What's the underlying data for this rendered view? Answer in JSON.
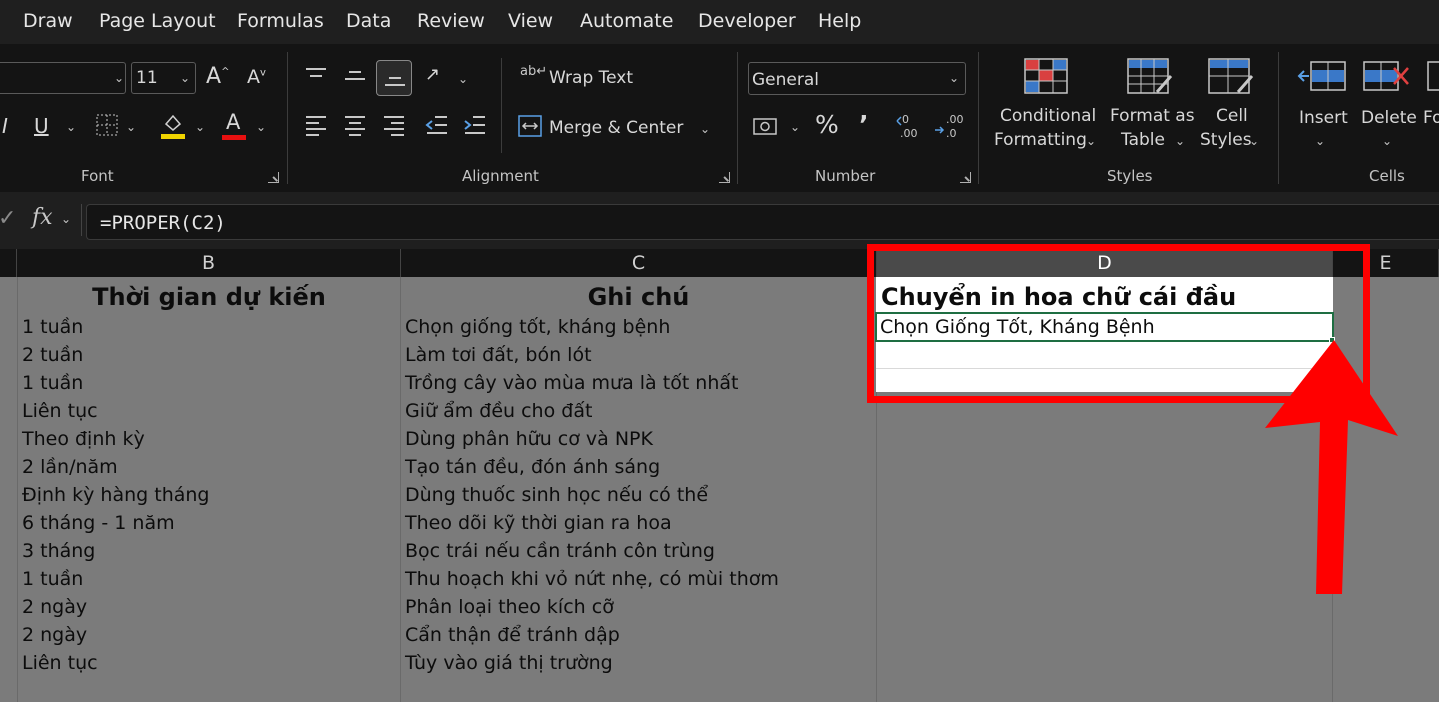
{
  "menu": {
    "items": [
      "Draw",
      "Page Layout",
      "Formulas",
      "Data",
      "Review",
      "View",
      "Automate",
      "Developer",
      "Help"
    ]
  },
  "ribbon": {
    "font": {
      "size_value": "11",
      "group_label": "Font"
    },
    "alignment": {
      "wrap_text_label": "Wrap Text",
      "merge_center_label": "Merge & Center",
      "group_label": "Alignment"
    },
    "number": {
      "format_value": "General",
      "group_label": "Number"
    },
    "styles": {
      "conditional_formatting": [
        "Conditional",
        "Formatting"
      ],
      "format_as_table": [
        "Format as",
        "Table"
      ],
      "cell_styles": [
        "Cell",
        "Styles"
      ],
      "group_label": "Styles"
    },
    "cells": {
      "insert_label": "Insert",
      "delete_label": "Delete",
      "format_label": "Fo",
      "group_label": "Cells"
    }
  },
  "formula_bar": {
    "fx_label": "fx",
    "formula": "=PROPER(C2)"
  },
  "columns": [
    "B",
    "C",
    "D",
    "E"
  ],
  "sheet": {
    "header_b": "Thời gian dự kiến",
    "header_c": "Ghi chú",
    "header_d": "Chuyển in hoa chữ cái đầu",
    "result_d2": "Chọn Giống Tốt, Kháng Bệnh",
    "rows": [
      {
        "b": "1 tuần",
        "c": "Chọn giống tốt, kháng bệnh"
      },
      {
        "b": "2 tuần",
        "c": "Làm tơi đất, bón lót"
      },
      {
        "b": "1 tuần",
        "c": "Trồng cây vào mùa mưa là tốt nhất"
      },
      {
        "b": "Liên tục",
        "c": "Giữ ẩm đều cho đất"
      },
      {
        "b": "Theo định kỳ",
        "c": "Dùng phân hữu cơ và NPK"
      },
      {
        "b": "2 lần/năm",
        "c": "Tạo tán đều, đón ánh sáng"
      },
      {
        "b": "Định kỳ hàng tháng",
        "c": "Dùng thuốc sinh học nếu có thể"
      },
      {
        "b": "6 tháng - 1 năm",
        "c": "Theo dõi kỹ thời gian ra hoa"
      },
      {
        "b": "3 tháng",
        "c": "Bọc trái nếu cần tránh côn trùng"
      },
      {
        "b": "1 tuần",
        "c": "Thu hoạch khi vỏ nứt nhẹ, có mùi thơm"
      },
      {
        "b": "2 ngày",
        "c": "Phân loại theo kích cỡ"
      },
      {
        "b": "2 ngày",
        "c": "Cẩn thận để tránh dập"
      },
      {
        "b": "Liên tục",
        "c": "Tùy vào giá thị trường"
      }
    ]
  },
  "colors": {
    "annotation_red": "#ff0000",
    "selection_green": "#1e6e42"
  }
}
